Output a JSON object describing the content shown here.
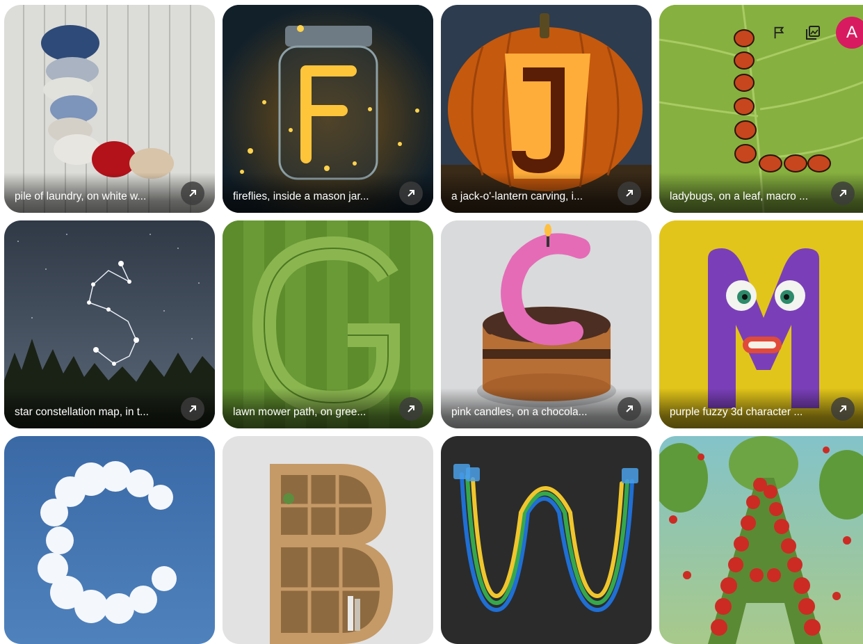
{
  "cards": [
    {
      "caption": "pile of laundry, on white w..."
    },
    {
      "caption": "fireflies, inside a mason jar..."
    },
    {
      "caption": "a jack-o'-lantern carving, i..."
    },
    {
      "caption": "ladybugs, on a leaf, macro ..."
    },
    {
      "caption": "star constellation map, in t..."
    },
    {
      "caption": "lawn mower path, on gree..."
    },
    {
      "caption": "pink candles, on a chocola..."
    },
    {
      "caption": "purple fuzzy 3d character ..."
    },
    {
      "caption": ""
    },
    {
      "caption": ""
    },
    {
      "caption": ""
    },
    {
      "caption": ""
    }
  ],
  "header": {
    "avatar_letter": "A",
    "icons": [
      "flag-icon",
      "gallery-icon"
    ]
  },
  "colors": {
    "avatar": "#d81b60",
    "button_bg": "#3c3c3c",
    "caption_text": "#ffffff"
  }
}
